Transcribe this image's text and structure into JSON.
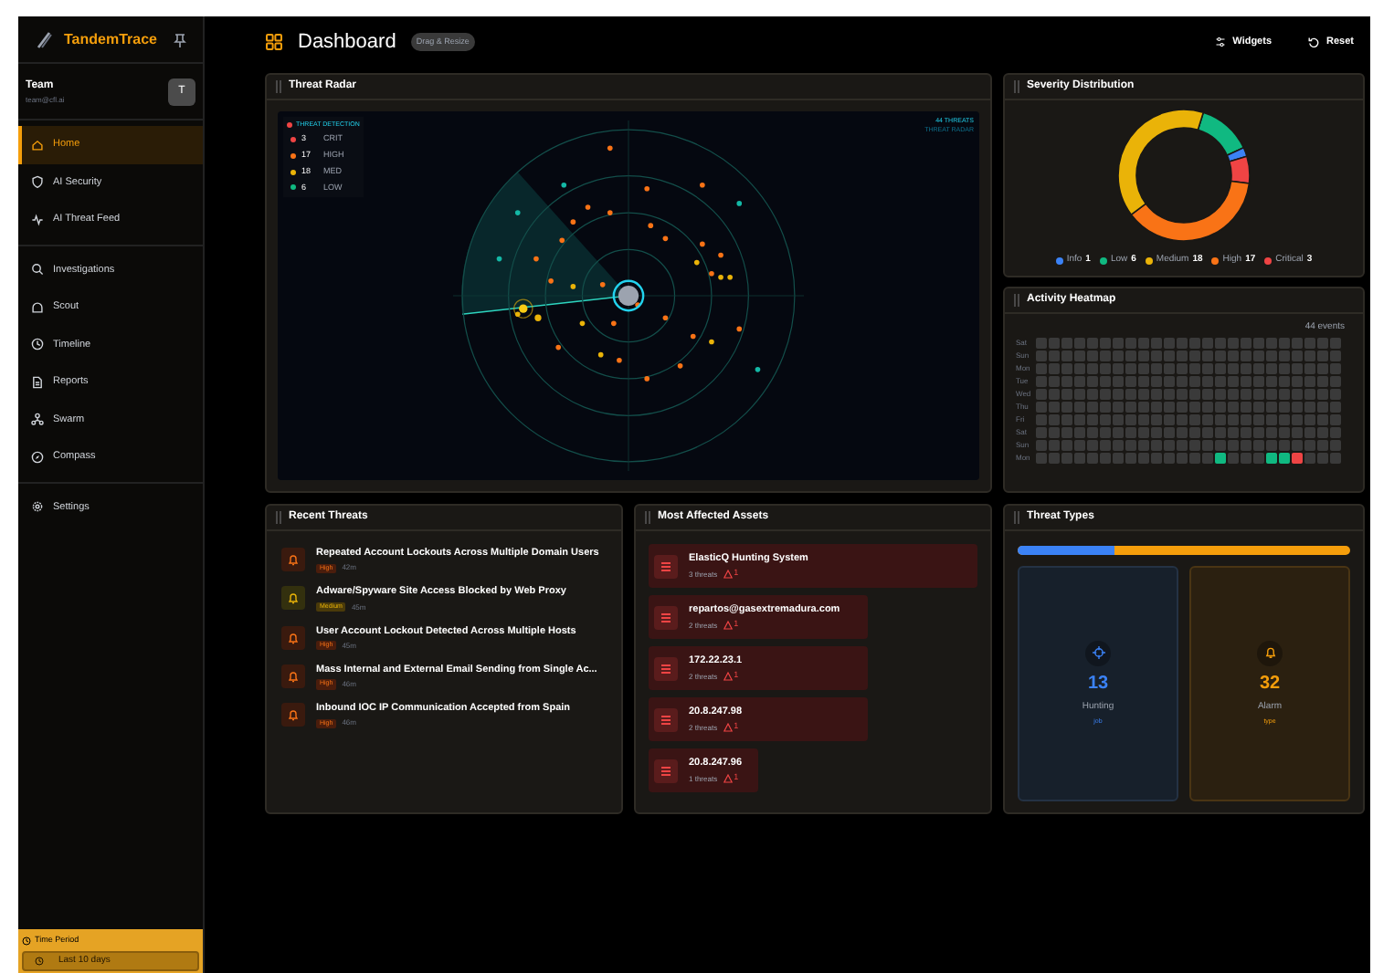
{
  "sidebar": {
    "brand": "TandemTrace",
    "user": {
      "name": "Team",
      "email": "team@cfl.ai",
      "avatar": "T"
    },
    "groups": [
      [
        {
          "label": "Home",
          "selected": true
        },
        {
          "label": "AI Security",
          "selected": false
        },
        {
          "label": "AI Threat Feed",
          "selected": false
        }
      ],
      [
        {
          "label": "Investigations",
          "selected": false
        },
        {
          "label": "Scout",
          "selected": false
        },
        {
          "label": "Timeline",
          "selected": false
        },
        {
          "label": "Reports",
          "selected": false
        },
        {
          "label": "Swarm",
          "selected": false
        },
        {
          "label": "Compass",
          "selected": false
        }
      ],
      [
        {
          "label": "Settings",
          "selected": false
        }
      ]
    ],
    "time_period": {
      "label": "Time Period",
      "value": "Last 10 days"
    }
  },
  "header": {
    "title": "Dashboard",
    "badge": "Drag & Resize",
    "actions": [
      "Widgets",
      "Reset"
    ]
  },
  "threat_radar": {
    "title": "Threat Radar",
    "legend_title": "THREAT DETECTION",
    "legend": [
      {
        "count": "3",
        "label": "CRIT",
        "color": "#ef4444"
      },
      {
        "count": "17",
        "label": "HIGH",
        "color": "#f97316"
      },
      {
        "count": "18",
        "label": "MED",
        "color": "#eab308"
      },
      {
        "count": "6",
        "label": "LOW",
        "color": "#10b981"
      }
    ],
    "summary": [
      "44 THREATS",
      "THREAT RADAR"
    ]
  },
  "severity_distribution": {
    "title": "Severity Distribution",
    "legend": [
      {
        "label": "Info",
        "value": "1",
        "color": "#3b82f6"
      },
      {
        "label": "Low",
        "value": "6",
        "color": "#10b981"
      },
      {
        "label": "Medium",
        "value": "18",
        "color": "#eab308"
      },
      {
        "label": "High",
        "value": "17",
        "color": "#f97316"
      },
      {
        "label": "Critical",
        "value": "3",
        "color": "#ef4444"
      }
    ]
  },
  "activity_heatmap": {
    "title": "Activity Heatmap",
    "total": "44 events",
    "days": [
      {
        "label": "Sat",
        "cells": [
          {
            "color": "#3a3a3a"
          },
          {
            "color": "#3a3a3a"
          },
          {
            "color": "#3a3a3a"
          },
          {
            "color": "#3a3a3a"
          },
          {
            "color": "#3a3a3a"
          },
          {
            "color": "#3a3a3a"
          },
          {
            "color": "#3a3a3a"
          },
          {
            "color": "#3a3a3a"
          },
          {
            "color": "#3a3a3a"
          },
          {
            "color": "#3a3a3a"
          },
          {
            "color": "#3a3a3a"
          },
          {
            "color": "#3a3a3a"
          },
          {
            "color": "#3a3a3a"
          },
          {
            "color": "#3a3a3a"
          },
          {
            "color": "#3a3a3a"
          },
          {
            "color": "#3a3a3a"
          },
          {
            "color": "#3a3a3a"
          },
          {
            "color": "#3a3a3a"
          },
          {
            "color": "#3a3a3a"
          },
          {
            "color": "#3a3a3a"
          },
          {
            "color": "#3a3a3a"
          },
          {
            "color": "#3a3a3a"
          },
          {
            "color": "#3a3a3a"
          },
          {
            "color": "#3a3a3a"
          }
        ]
      },
      {
        "label": "Sun",
        "cells": [
          {
            "color": "#3a3a3a"
          },
          {
            "color": "#3a3a3a"
          },
          {
            "color": "#3a3a3a"
          },
          {
            "color": "#3a3a3a"
          },
          {
            "color": "#3a3a3a"
          },
          {
            "color": "#3a3a3a"
          },
          {
            "color": "#3a3a3a"
          },
          {
            "color": "#3a3a3a"
          },
          {
            "color": "#3a3a3a"
          },
          {
            "color": "#3a3a3a"
          },
          {
            "color": "#3a3a3a"
          },
          {
            "color": "#3a3a3a"
          },
          {
            "color": "#3a3a3a"
          },
          {
            "color": "#3a3a3a"
          },
          {
            "color": "#3a3a3a"
          },
          {
            "color": "#3a3a3a"
          },
          {
            "color": "#3a3a3a"
          },
          {
            "color": "#3a3a3a"
          },
          {
            "color": "#3a3a3a"
          },
          {
            "color": "#3a3a3a"
          },
          {
            "color": "#3a3a3a"
          },
          {
            "color": "#3a3a3a"
          },
          {
            "color": "#3a3a3a"
          },
          {
            "color": "#3a3a3a"
          }
        ]
      },
      {
        "label": "Mon",
        "cells": [
          {
            "color": "#3a3a3a"
          },
          {
            "color": "#3a3a3a"
          },
          {
            "color": "#3a3a3a"
          },
          {
            "color": "#3a3a3a"
          },
          {
            "color": "#3a3a3a"
          },
          {
            "color": "#3a3a3a"
          },
          {
            "color": "#3a3a3a"
          },
          {
            "color": "#3a3a3a"
          },
          {
            "color": "#3a3a3a"
          },
          {
            "color": "#3a3a3a"
          },
          {
            "color": "#3a3a3a"
          },
          {
            "color": "#3a3a3a"
          },
          {
            "color": "#3a3a3a"
          },
          {
            "color": "#3a3a3a"
          },
          {
            "color": "#3a3a3a"
          },
          {
            "color": "#3a3a3a"
          },
          {
            "color": "#3a3a3a"
          },
          {
            "color": "#3a3a3a"
          },
          {
            "color": "#3a3a3a"
          },
          {
            "color": "#3a3a3a"
          },
          {
            "color": "#3a3a3a"
          },
          {
            "color": "#3a3a3a"
          },
          {
            "color": "#3a3a3a"
          },
          {
            "color": "#3a3a3a"
          }
        ]
      },
      {
        "label": "Tue",
        "cells": [
          {
            "color": "#3a3a3a"
          },
          {
            "color": "#3a3a3a"
          },
          {
            "color": "#3a3a3a"
          },
          {
            "color": "#3a3a3a"
          },
          {
            "color": "#3a3a3a"
          },
          {
            "color": "#3a3a3a"
          },
          {
            "color": "#3a3a3a"
          },
          {
            "color": "#3a3a3a"
          },
          {
            "color": "#3a3a3a"
          },
          {
            "color": "#3a3a3a"
          },
          {
            "color": "#3a3a3a"
          },
          {
            "color": "#3a3a3a"
          },
          {
            "color": "#3a3a3a"
          },
          {
            "color": "#3a3a3a"
          },
          {
            "color": "#3a3a3a"
          },
          {
            "color": "#3a3a3a"
          },
          {
            "color": "#3a3a3a"
          },
          {
            "color": "#3a3a3a"
          },
          {
            "color": "#3a3a3a"
          },
          {
            "color": "#3a3a3a"
          },
          {
            "color": "#3a3a3a"
          },
          {
            "color": "#3a3a3a"
          },
          {
            "color": "#3a3a3a"
          },
          {
            "color": "#3a3a3a"
          }
        ]
      },
      {
        "label": "Wed",
        "cells": [
          {
            "color": "#3a3a3a"
          },
          {
            "color": "#3a3a3a"
          },
          {
            "color": "#3a3a3a"
          },
          {
            "color": "#3a3a3a"
          },
          {
            "color": "#3a3a3a"
          },
          {
            "color": "#3a3a3a"
          },
          {
            "color": "#3a3a3a"
          },
          {
            "color": "#3a3a3a"
          },
          {
            "color": "#3a3a3a"
          },
          {
            "color": "#3a3a3a"
          },
          {
            "color": "#3a3a3a"
          },
          {
            "color": "#3a3a3a"
          },
          {
            "color": "#3a3a3a"
          },
          {
            "color": "#3a3a3a"
          },
          {
            "color": "#3a3a3a"
          },
          {
            "color": "#3a3a3a"
          },
          {
            "color": "#3a3a3a"
          },
          {
            "color": "#3a3a3a"
          },
          {
            "color": "#3a3a3a"
          },
          {
            "color": "#3a3a3a"
          },
          {
            "color": "#3a3a3a"
          },
          {
            "color": "#3a3a3a"
          },
          {
            "color": "#3a3a3a"
          },
          {
            "color": "#3a3a3a"
          }
        ]
      },
      {
        "label": "Thu",
        "cells": [
          {
            "color": "#3a3a3a"
          },
          {
            "color": "#3a3a3a"
          },
          {
            "color": "#3a3a3a"
          },
          {
            "color": "#3a3a3a"
          },
          {
            "color": "#3a3a3a"
          },
          {
            "color": "#3a3a3a"
          },
          {
            "color": "#3a3a3a"
          },
          {
            "color": "#3a3a3a"
          },
          {
            "color": "#3a3a3a"
          },
          {
            "color": "#3a3a3a"
          },
          {
            "color": "#3a3a3a"
          },
          {
            "color": "#3a3a3a"
          },
          {
            "color": "#3a3a3a"
          },
          {
            "color": "#3a3a3a"
          },
          {
            "color": "#3a3a3a"
          },
          {
            "color": "#3a3a3a"
          },
          {
            "color": "#3a3a3a"
          },
          {
            "color": "#3a3a3a"
          },
          {
            "color": "#3a3a3a"
          },
          {
            "color": "#3a3a3a"
          },
          {
            "color": "#3a3a3a"
          },
          {
            "color": "#3a3a3a"
          },
          {
            "color": "#3a3a3a"
          },
          {
            "color": "#3a3a3a"
          }
        ]
      },
      {
        "label": "Fri",
        "cells": [
          {
            "color": "#3a3a3a"
          },
          {
            "color": "#3a3a3a"
          },
          {
            "color": "#3a3a3a"
          },
          {
            "color": "#3a3a3a"
          },
          {
            "color": "#3a3a3a"
          },
          {
            "color": "#3a3a3a"
          },
          {
            "color": "#3a3a3a"
          },
          {
            "color": "#3a3a3a"
          },
          {
            "color": "#3a3a3a"
          },
          {
            "color": "#3a3a3a"
          },
          {
            "color": "#3a3a3a"
          },
          {
            "color": "#3a3a3a"
          },
          {
            "color": "#3a3a3a"
          },
          {
            "color": "#3a3a3a"
          },
          {
            "color": "#3a3a3a"
          },
          {
            "color": "#3a3a3a"
          },
          {
            "color": "#3a3a3a"
          },
          {
            "color": "#3a3a3a"
          },
          {
            "color": "#3a3a3a"
          },
          {
            "color": "#3a3a3a"
          },
          {
            "color": "#3a3a3a"
          },
          {
            "color": "#3a3a3a"
          },
          {
            "color": "#3a3a3a"
          },
          {
            "color": "#3a3a3a"
          }
        ]
      },
      {
        "label": "Sat",
        "cells": [
          {
            "color": "#3a3a3a"
          },
          {
            "color": "#3a3a3a"
          },
          {
            "color": "#3a3a3a"
          },
          {
            "color": "#3a3a3a"
          },
          {
            "color": "#3a3a3a"
          },
          {
            "color": "#3a3a3a"
          },
          {
            "color": "#3a3a3a"
          },
          {
            "color": "#3a3a3a"
          },
          {
            "color": "#3a3a3a"
          },
          {
            "color": "#3a3a3a"
          },
          {
            "color": "#3a3a3a"
          },
          {
            "color": "#3a3a3a"
          },
          {
            "color": "#3a3a3a"
          },
          {
            "color": "#3a3a3a"
          },
          {
            "color": "#3a3a3a"
          },
          {
            "color": "#3a3a3a"
          },
          {
            "color": "#3a3a3a"
          },
          {
            "color": "#3a3a3a"
          },
          {
            "color": "#3a3a3a"
          },
          {
            "color": "#3a3a3a"
          },
          {
            "color": "#3a3a3a"
          },
          {
            "color": "#3a3a3a"
          },
          {
            "color": "#3a3a3a"
          },
          {
            "color": "#3a3a3a"
          }
        ]
      },
      {
        "label": "Sun",
        "cells": [
          {
            "color": "#3a3a3a"
          },
          {
            "color": "#3a3a3a"
          },
          {
            "color": "#3a3a3a"
          },
          {
            "color": "#3a3a3a"
          },
          {
            "color": "#3a3a3a"
          },
          {
            "color": "#3a3a3a"
          },
          {
            "color": "#3a3a3a"
          },
          {
            "color": "#3a3a3a"
          },
          {
            "color": "#3a3a3a"
          },
          {
            "color": "#3a3a3a"
          },
          {
            "color": "#3a3a3a"
          },
          {
            "color": "#3a3a3a"
          },
          {
            "color": "#3a3a3a"
          },
          {
            "color": "#3a3a3a"
          },
          {
            "color": "#3a3a3a"
          },
          {
            "color": "#3a3a3a"
          },
          {
            "color": "#3a3a3a"
          },
          {
            "color": "#3a3a3a"
          },
          {
            "color": "#3a3a3a"
          },
          {
            "color": "#3a3a3a"
          },
          {
            "color": "#3a3a3a"
          },
          {
            "color": "#3a3a3a"
          },
          {
            "color": "#3a3a3a"
          },
          {
            "color": "#3a3a3a"
          }
        ]
      },
      {
        "label": "Mon",
        "cells": [
          {
            "color": "#3a3a3a"
          },
          {
            "color": "#3a3a3a"
          },
          {
            "color": "#3a3a3a"
          },
          {
            "color": "#3a3a3a"
          },
          {
            "color": "#3a3a3a"
          },
          {
            "color": "#3a3a3a"
          },
          {
            "color": "#3a3a3a"
          },
          {
            "color": "#3a3a3a"
          },
          {
            "color": "#3a3a3a"
          },
          {
            "color": "#3a3a3a"
          },
          {
            "color": "#3a3a3a"
          },
          {
            "color": "#3a3a3a"
          },
          {
            "color": "#3a3a3a"
          },
          {
            "color": "#3a3a3a"
          },
          {
            "color": "#10b981"
          },
          {
            "color": "#3a3a3a"
          },
          {
            "color": "#3a3a3a"
          },
          {
            "color": "#3a3a3a"
          },
          {
            "color": "#10b981"
          },
          {
            "color": "#10b981"
          },
          {
            "color": "#ef4444"
          },
          {
            "color": "#3a3a3a"
          },
          {
            "color": "#3a3a3a"
          },
          {
            "color": "#3a3a3a"
          }
        ]
      }
    ]
  },
  "recent_threats": {
    "title": "Recent Threats",
    "items": [
      {
        "title": "Repeated Account Lockouts Across Multiple Domain Users",
        "severity": "High",
        "time": "42m"
      },
      {
        "title": "Adware/Spyware Site Access Blocked by Web Proxy",
        "severity": "Medium",
        "time": "45m"
      },
      {
        "title": "User Account Lockout Detected Across Multiple Hosts",
        "severity": "High",
        "time": "45m"
      },
      {
        "title": "Mass Internal and External Email Sending from Single Ac...",
        "severity": "High",
        "time": "46m"
      },
      {
        "title": "Inbound IOC IP Communication Accepted from Spain",
        "severity": "High",
        "time": "46m"
      }
    ]
  },
  "most_affected_assets": {
    "title": "Most Affected Assets",
    "items": [
      {
        "name": "ElasticQ Hunting System",
        "threats": "3 threats",
        "critical": "1"
      },
      {
        "name": "repartos@gasextremadura.com",
        "threats": "2 threats",
        "critical": "1"
      },
      {
        "name": "172.22.23.1",
        "threats": "2 threats",
        "critical": "1"
      },
      {
        "name": "20.8.247.98",
        "threats": "2 threats",
        "critical": "1"
      },
      {
        "name": "20.8.247.96",
        "threats": "1 threats",
        "critical": "1"
      }
    ]
  },
  "threat_types": {
    "title": "Threat Types",
    "bar": {
      "level": 0.29
    },
    "cards": [
      {
        "kind": "hunting",
        "value": "13",
        "label": "Hunting",
        "sub": "job"
      },
      {
        "kind": "alarm",
        "value": "32",
        "label": "Alarm",
        "sub": "type"
      }
    ]
  }
}
